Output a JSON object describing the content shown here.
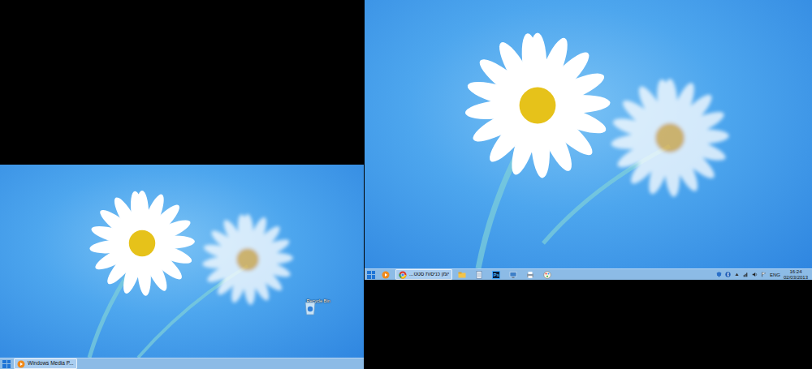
{
  "screens": [
    {
      "desktop_icons": [
        {
          "label": "Recycle Bin",
          "kind": "bin"
        }
      ],
      "taskbar": {
        "items": [
          {
            "kind": "start",
            "open": false
          },
          {
            "kind": "media",
            "label": "Windows Media P...",
            "open": true
          }
        ]
      }
    },
    {
      "desktop_icons": [],
      "taskbar": {
        "items": [
          {
            "kind": "start",
            "open": false
          },
          {
            "kind": "media",
            "open": false
          },
          {
            "kind": "chrome",
            "label": "יומן כניסות סטט...",
            "open": true
          },
          {
            "kind": "folder",
            "open": false
          },
          {
            "kind": "notepad",
            "open": false
          },
          {
            "kind": "ps",
            "text": "Ps",
            "open": false
          },
          {
            "kind": "monitor",
            "open": false
          },
          {
            "kind": "printer",
            "open": false
          },
          {
            "kind": "paint",
            "open": false
          }
        ],
        "tray": {
          "icons": [
            {
              "kind": "shield"
            },
            {
              "kind": "bluetooth"
            },
            {
              "kind": "arrow"
            },
            {
              "kind": "network"
            },
            {
              "kind": "volume"
            },
            {
              "kind": "flag"
            }
          ],
          "language": "ENG",
          "time": "16:24",
          "date": "02/03/2013"
        }
      }
    }
  ]
}
